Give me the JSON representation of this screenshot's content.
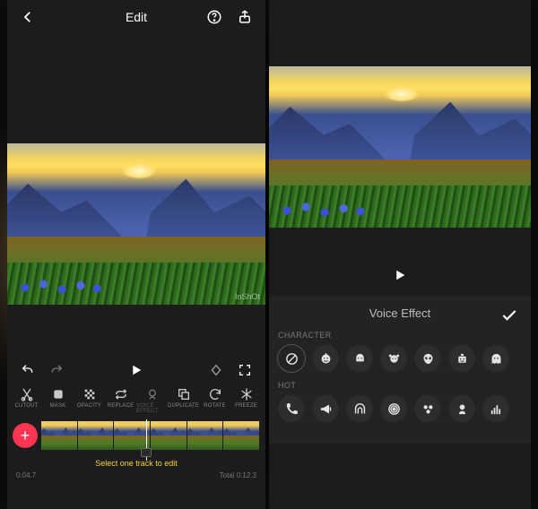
{
  "left": {
    "title": "Edit",
    "watermark": "InShOt",
    "tools": [
      {
        "id": "cutout",
        "label": "CUTOUT"
      },
      {
        "id": "mask",
        "label": "MASK"
      },
      {
        "id": "opacity",
        "label": "OPACITY"
      },
      {
        "id": "replace",
        "label": "REPLACE"
      },
      {
        "id": "voice-effect",
        "label": "VOICE EFFECT"
      },
      {
        "id": "duplicate",
        "label": "DUPLICATE"
      },
      {
        "id": "rotate",
        "label": "ROTATE"
      },
      {
        "id": "freeze",
        "label": "FREEZE"
      }
    ],
    "hint": "Select one track to edit",
    "time_current": "0:04.7",
    "time_total": "Total 0:12.3"
  },
  "right": {
    "panel_title": "Voice Effect",
    "group1": "CHARACTER",
    "group2": "HOT",
    "characters": [
      {
        "name": "none"
      },
      {
        "name": "baby"
      },
      {
        "name": "woman"
      },
      {
        "name": "girl"
      },
      {
        "name": "alien"
      },
      {
        "name": "robot"
      },
      {
        "name": "ghost"
      }
    ],
    "hot": [
      {
        "name": "phone"
      },
      {
        "name": "megaphone"
      },
      {
        "name": "cave"
      },
      {
        "name": "spiral"
      },
      {
        "name": "cluster"
      },
      {
        "name": "voice"
      },
      {
        "name": "equalizer"
      }
    ]
  }
}
